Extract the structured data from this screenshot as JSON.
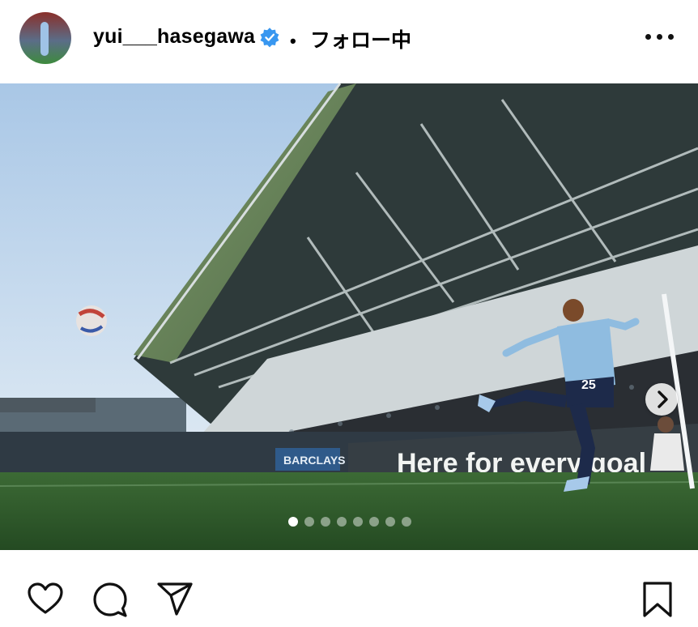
{
  "post": {
    "username": "yui___hasegawa",
    "separator": "•",
    "follow_status": "フォロー中",
    "verified": true,
    "accent_color": "#3897f0"
  },
  "photo": {
    "banner_text": "Here for every goal",
    "sponsor_text": "BARCLAYS",
    "jersey_number": "25",
    "carousel_count": 8,
    "carousel_active_index": 0
  },
  "icons": {
    "avatar": "avatar",
    "verified": "verified-badge-icon",
    "more": "more-options-icon",
    "next": "chevron-right-icon",
    "like": "heart-icon",
    "comment": "comment-bubble-icon",
    "share": "paper-plane-icon",
    "save": "bookmark-icon"
  }
}
